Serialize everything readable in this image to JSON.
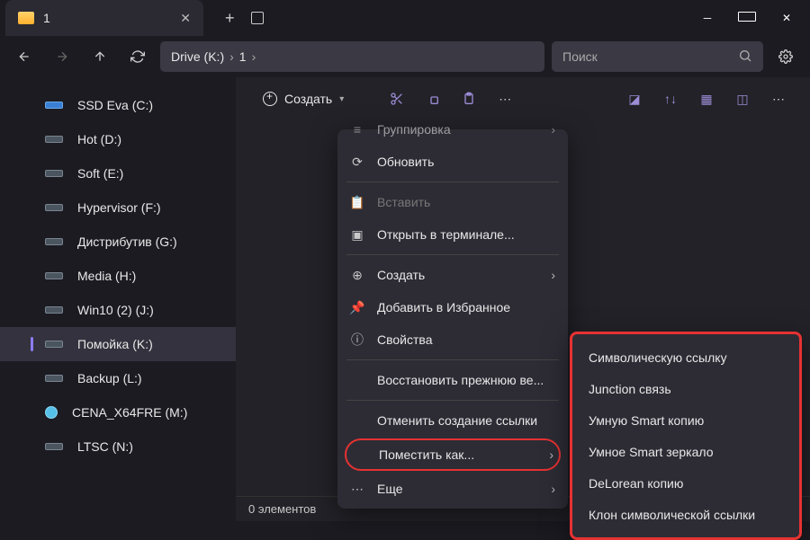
{
  "tab": {
    "title": "1"
  },
  "address": {
    "crumbs": [
      "Drive (K:)",
      "1"
    ]
  },
  "search": {
    "placeholder": "Поиск"
  },
  "toolbar": {
    "new_label": "Создать"
  },
  "sidebar": [
    {
      "label": "SSD Eva (C:)",
      "icon": "ssd"
    },
    {
      "label": "Hot (D:)",
      "icon": "hdd"
    },
    {
      "label": "Soft (E:)",
      "icon": "hdd"
    },
    {
      "label": "Hypervisor (F:)",
      "icon": "hdd"
    },
    {
      "label": "Дистрибутив (G:)",
      "icon": "hdd"
    },
    {
      "label": "Media (H:)",
      "icon": "hdd"
    },
    {
      "label": "Win10 (2) (J:)",
      "icon": "hdd"
    },
    {
      "label": "Помойка (K:)",
      "icon": "hdd",
      "active": true
    },
    {
      "label": "Backup (L:)",
      "icon": "hdd"
    },
    {
      "label": "CENA_X64FRE (M:)",
      "icon": "disc"
    },
    {
      "label": "LTSC (N:)",
      "icon": "hdd"
    }
  ],
  "status": "0 элементов",
  "context_menu": [
    {
      "label": "Группировка",
      "icon": "group",
      "arrow": true,
      "top_cut": true
    },
    {
      "label": "Обновить",
      "icon": "refresh"
    },
    {
      "sep": true
    },
    {
      "label": "Вставить",
      "icon": "paste",
      "disabled": true
    },
    {
      "label": "Открыть в терминале...",
      "icon": "terminal"
    },
    {
      "sep": true
    },
    {
      "label": "Создать",
      "icon": "new",
      "arrow": true
    },
    {
      "label": "Добавить в Избранное",
      "icon": "pin"
    },
    {
      "label": "Свойства",
      "icon": "info"
    },
    {
      "sep": true
    },
    {
      "label": "Восстановить прежнюю ве...",
      "icon": "none"
    },
    {
      "sep": true
    },
    {
      "label": "Отменить создание ссылки",
      "icon": "none"
    },
    {
      "label": "Поместить как...",
      "icon": "none",
      "arrow": true,
      "highlight": true
    },
    {
      "label": "Еще",
      "icon": "more",
      "arrow": true
    }
  ],
  "submenu": [
    "Символическую ссылку",
    "Junction связь",
    "Умную Smart копию",
    "Умное Smart зеркало",
    "DeLorean копию",
    "Клон символической ссылки"
  ]
}
